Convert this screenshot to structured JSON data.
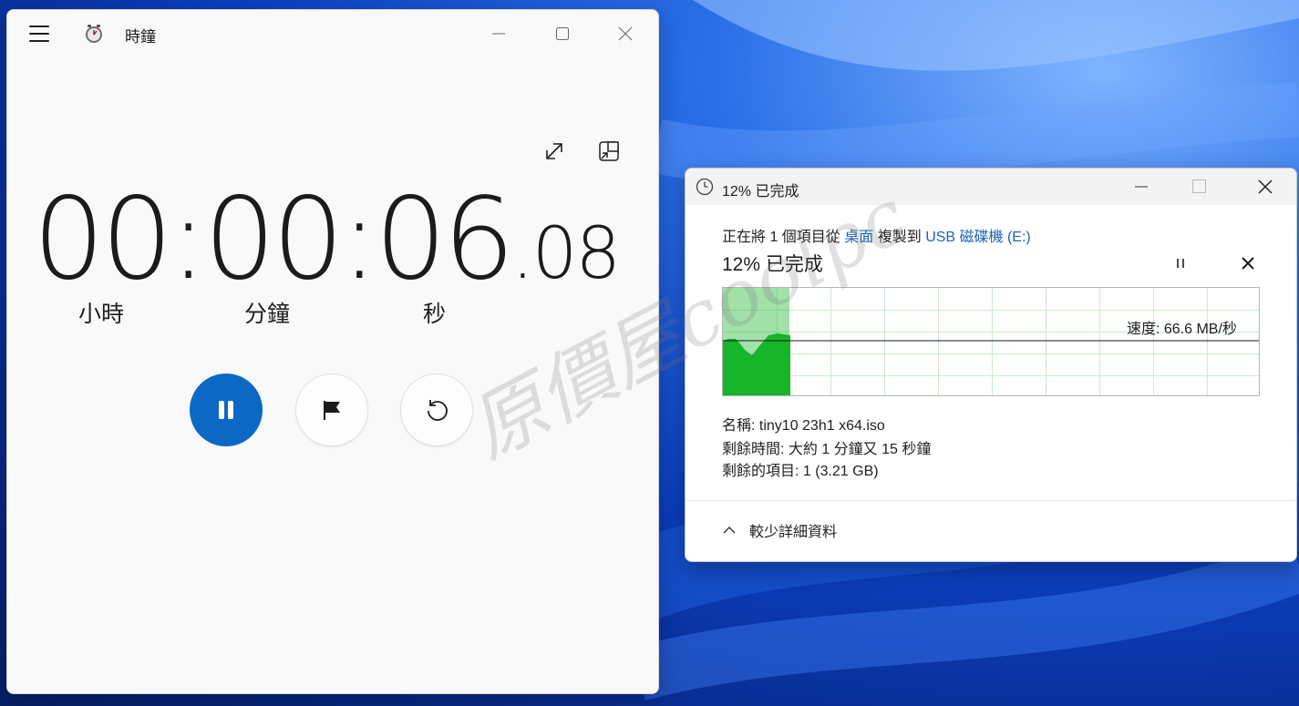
{
  "clock": {
    "title": "時鐘",
    "time": {
      "hours": "00",
      "minutes": "00",
      "seconds": "06",
      "hundredths": ".08",
      "sep1": ":",
      "sep2": ":"
    },
    "units": {
      "hours": "小時",
      "minutes": "分鐘",
      "seconds": "秒"
    },
    "icons": [
      "hamburger-menu-icon",
      "alarm-clock-icon",
      "minimize-icon",
      "maximize-icon",
      "close-icon",
      "expand-icon",
      "compact-overlay-icon",
      "pause-icon",
      "flag-icon",
      "reset-icon"
    ],
    "accent": "#0b68c4"
  },
  "copy": {
    "title": "12% 已完成",
    "source_prefix": "正在將 1 個項目從",
    "source_from": "桌面",
    "source_mid": "複製到",
    "source_to": "USB 磁碟機 (E:)",
    "percent": "12% 已完成",
    "progress": 0.12,
    "speed": "速度: 66.6 MB/秒",
    "name": "名稱: tiny10 23h1 x64.iso",
    "time_remaining": "剩餘時間: 大約 1 分鐘又 15 秒鐘",
    "items_remaining": "剩餘的項目: 1 (3.21 GB)",
    "details_toggle": "較少詳細資料",
    "graph_color": "#16b52a",
    "link_color": "#1a63b8"
  },
  "watermark": "原價屋coolpc"
}
